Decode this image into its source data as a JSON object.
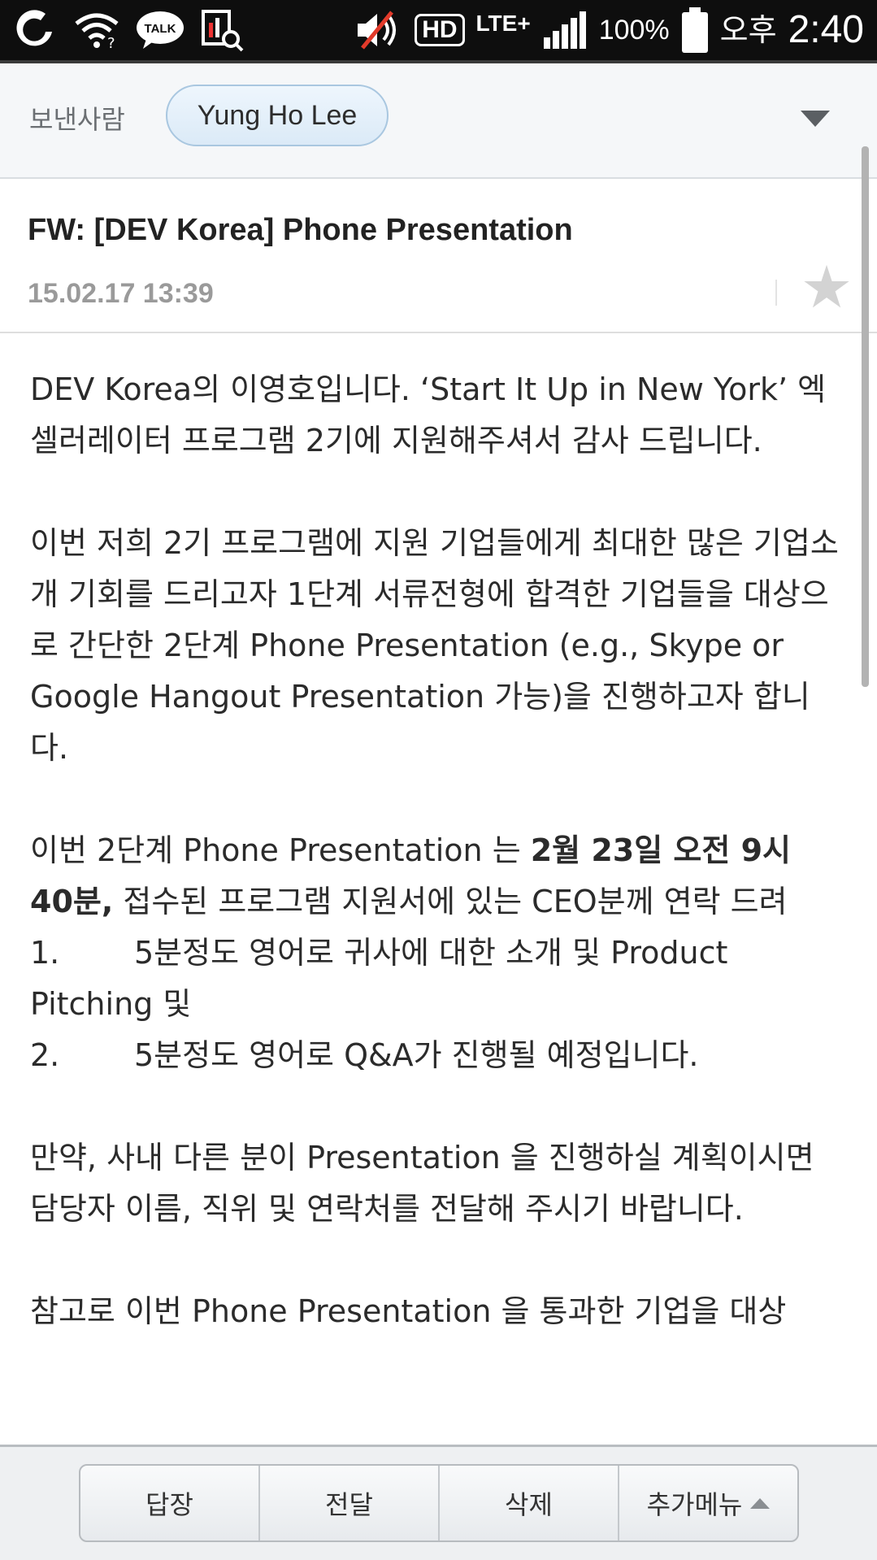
{
  "status_bar": {
    "battery": "100%",
    "ampm": "오후",
    "time": "2:40",
    "network": "LTE+",
    "hd": "HD",
    "talk_label": "TALK",
    "icons": [
      "olleh-icon",
      "wifi-icon",
      "kakaotalk-icon",
      "screen-search-icon",
      "mute-icon",
      "hd-voice-icon",
      "lte-icon",
      "signal-icon",
      "battery-icon"
    ]
  },
  "sender": {
    "label": "보낸사람",
    "name": "Yung Ho Lee"
  },
  "message": {
    "subject": "FW: [DEV Korea] Phone Presentation",
    "date": "15.02.17 13:39",
    "p1": "DEV Korea의 이영호입니다. ‘Start It Up in New York’ 엑셀러레이터 프로그램 2기에 지원해주셔서 감사 드립니다.",
    "p2": "이번 저희 2기 프로그램에 지원 기업들에게 최대한 많은 기업소개 기회를 드리고자 1단계 서류전형에 합격한 기업들을 대상으로 간단한 2단계 Phone Presentation (e.g., Skype or Google Hangout Presentation 가능)을 진행하고자 합니다.",
    "p3_pre": "이번 2단계 Phone Presentation 는 ",
    "p3_bold": "2월 23일 오전 9시 40분,",
    "p3_post": " 접수된 프로그램 지원서에 있는 CEO분께 연락 드려",
    "item1_num": "1.",
    "item1_text": "5분정도 영어로 귀사에 대한 소개 및 Product Pitching 및",
    "item2_num": "2.",
    "item2_text": "5분정도 영어로 Q&A가 진행될 예정입니다.",
    "p4": "만약, 사내 다른 분이 Presentation 을 진행하실 계획이시면 담당자 이름, 직위 및 연락처를 전달해 주시기 바랍니다.",
    "p5": "참고로 이번 Phone Presentation 을 통과한 기업을 대상"
  },
  "toolbar": {
    "reply": "답장",
    "forward": "전달",
    "delete": "삭제",
    "more": "추가메뉴"
  },
  "colors": {
    "status_bar_bg": "#0e0e0e",
    "chip_border": "#a9c7e0",
    "chip_fill": "#e4f0fa",
    "date_gray": "#9a9a9a"
  }
}
